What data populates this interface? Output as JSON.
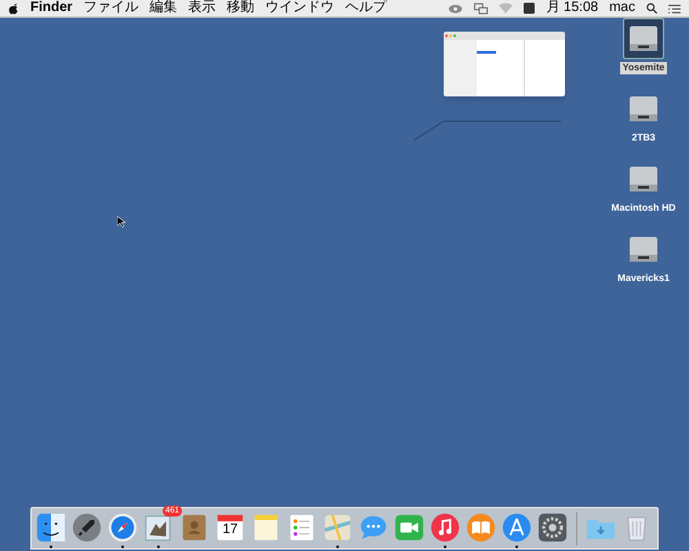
{
  "menu_bar": {
    "app_name": "Finder",
    "menus": [
      "ファイル",
      "編集",
      "表示",
      "移動",
      "ウインドウ",
      "ヘルプ"
    ],
    "clock": "月 15:08",
    "user": "mac"
  },
  "desktop_icons": [
    {
      "label": "Yosemite",
      "selected": true
    },
    {
      "label": "2TB3",
      "selected": false
    },
    {
      "label": "Macintosh HD",
      "selected": false
    },
    {
      "label": "Mavericks1",
      "selected": false
    }
  ],
  "dock": {
    "apps": [
      {
        "kind": "finder",
        "running": true
      },
      {
        "kind": "launchpad",
        "running": false
      },
      {
        "kind": "safari",
        "running": true
      },
      {
        "kind": "mail",
        "running": true,
        "badge": "461"
      },
      {
        "kind": "contacts",
        "running": false
      },
      {
        "kind": "calendar",
        "running": false,
        "date": "17"
      },
      {
        "kind": "notes",
        "running": false
      },
      {
        "kind": "reminders",
        "running": false
      },
      {
        "kind": "maps",
        "running": true
      },
      {
        "kind": "messages",
        "running": false
      },
      {
        "kind": "facetime",
        "running": false
      },
      {
        "kind": "itunes",
        "running": true
      },
      {
        "kind": "ibooks",
        "running": false
      },
      {
        "kind": "appstore",
        "running": true
      },
      {
        "kind": "preferences",
        "running": false
      }
    ],
    "stacks": [
      {
        "kind": "downloads"
      },
      {
        "kind": "trash"
      }
    ]
  }
}
